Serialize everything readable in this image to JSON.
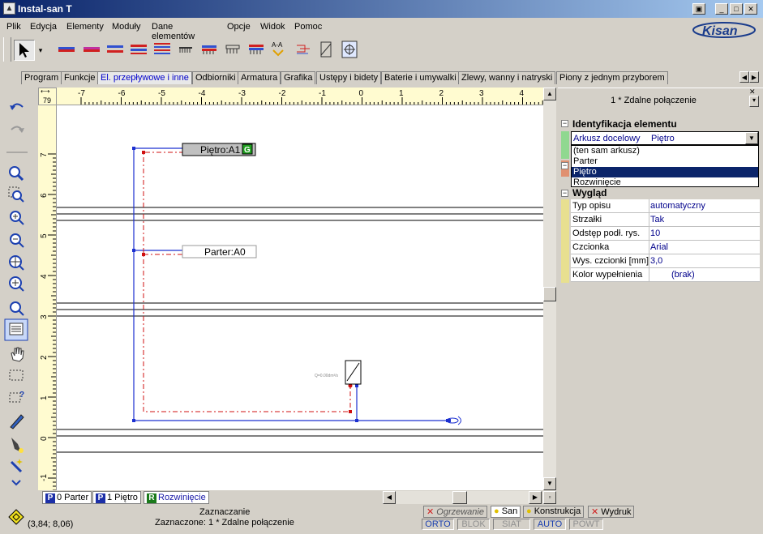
{
  "app": {
    "title": "Instal-san T",
    "logo": "Kisan"
  },
  "menu": [
    "Plik",
    "Edycja",
    "Elementy",
    "Moduły",
    "Dane elementów",
    "Opcje",
    "Widok",
    "Pomoc"
  ],
  "tabs": [
    "Program",
    "Funkcje",
    "El. przepływowe i inne",
    "Odbiorniki",
    "Armatura",
    "Grafika",
    "Ustępy i bidety",
    "Baterie i umywalki",
    "Zlewy, wanny i natryski",
    "Piony z jednym przyborem"
  ],
  "active_tab": "El. przepływowe i inne",
  "ruler": {
    "corner_value": "79",
    "h_labels": [
      "-7",
      "-6",
      "-5",
      "-4",
      "-3",
      "-2",
      "-1",
      "0",
      "1",
      "2",
      "3",
      "4"
    ],
    "v_labels": [
      "7",
      "6",
      "5",
      "4",
      "3",
      "2",
      "1",
      "0",
      "-1"
    ]
  },
  "drawing": {
    "label_pietro": "Piętro:A1",
    "label_pietro_badge": "G",
    "label_parter": "Parter:A0",
    "small_label": "Q=0.00dm³/s"
  },
  "sheets": [
    {
      "letter": "P",
      "label": "0 Parter",
      "color": "#1c2fa8"
    },
    {
      "letter": "P",
      "label": "1 Piętro",
      "color": "#1c2fa8"
    },
    {
      "letter": "R",
      "label": "Rozwinięcie",
      "color": "#1a7a1a"
    }
  ],
  "panel": {
    "header": "1 * Zdalne połączenie",
    "section_id": "Identyfikacja elementu",
    "arkusz_key": "Arkusz docelowy",
    "arkusz_value": "Piętro",
    "dropdown_options": [
      "(ten sam arkusz)",
      "Parter",
      "Piętro",
      "Rozwinięcie"
    ],
    "dropdown_selected": "Piętro",
    "section_look": "Wygląd",
    "props": [
      {
        "k": "Typ opisu",
        "v": "automatyczny"
      },
      {
        "k": "Strzałki",
        "v": "Tak"
      },
      {
        "k": "Odstęp podł. rys.",
        "v": "10"
      },
      {
        "k": "Czcionka",
        "v": "Arial"
      },
      {
        "k": "Wys. czcionki [mm]",
        "v": "3,0"
      },
      {
        "k": "Kolor wypełnienia",
        "v": "(brak)"
      }
    ]
  },
  "status": {
    "coords": "(3,84; 8,06)",
    "mode": "Zaznaczanie",
    "selected": "Zaznaczone: 1 * Zdalne połączenie",
    "modules": [
      "Ogrzewanie",
      "San",
      "Konstrukcja",
      "Wydruk"
    ],
    "flags": [
      "ORTO",
      "BLOK",
      "SIAT",
      "AUTO",
      "POWT"
    ]
  }
}
